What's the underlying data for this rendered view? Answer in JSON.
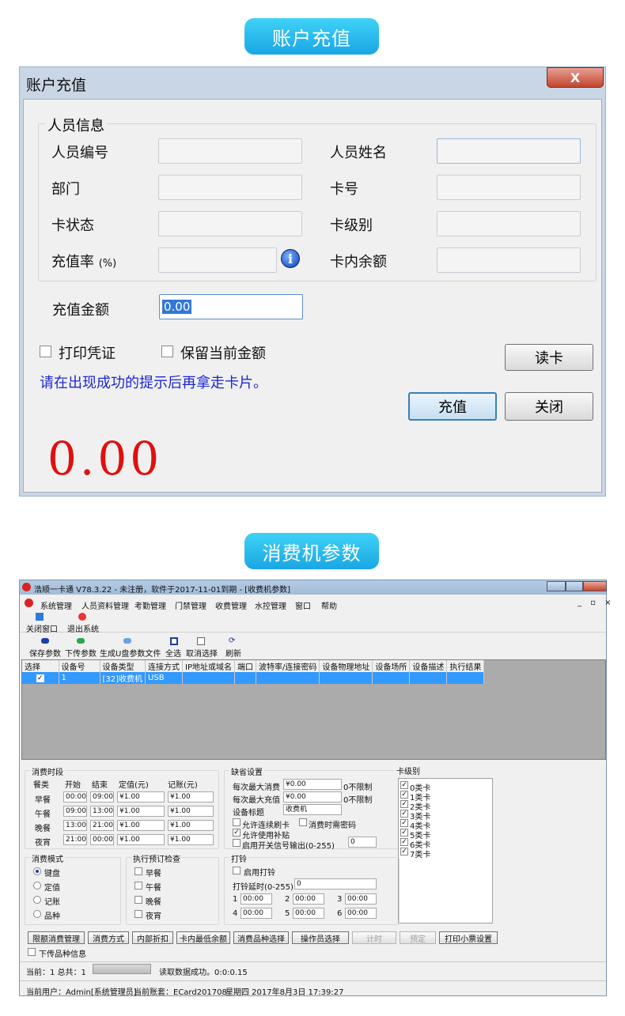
{
  "section1_title": "账户充值",
  "section2_title": "消费机参数",
  "recharge": {
    "window_title": "账户充值",
    "close_glyph": "X",
    "group_title": "人员信息",
    "labels": {
      "emp_no": "人员编号",
      "emp_name": "人员姓名",
      "dept": "部门",
      "card_no": "卡号",
      "card_status": "卡状态",
      "card_level": "卡级别",
      "rate": "充值率",
      "rate_unit": "(%)",
      "balance": "卡内余额",
      "amount": "充值金额"
    },
    "amount_value": "0.00",
    "print_voucher": "打印凭证",
    "keep_amount": "保留当前金额",
    "hint": "请在出现成功的提示后再拿走卡片。",
    "read_card": "读卡",
    "recharge_btn": "充值",
    "close_btn": "关闭",
    "big_amount": "0.00",
    "hint_color": "#1c27d6",
    "big_color": "#e01010"
  },
  "consume": {
    "title": "浩顺一卡通 V78.3.22 - 未注册，软件于2017-11-01到期 - [收费机参数]",
    "menu": [
      "系统管理",
      "人员资料管理",
      "考勤管理",
      "门禁管理",
      "收费管理",
      "水控管理",
      "窗口",
      "帮助"
    ],
    "mdi_controls": "_ ▫ ×",
    "toolbar1": [
      "关闭窗口",
      "退出系统"
    ],
    "toolbar2": [
      "保存参数",
      "下传参数",
      "生成U盘参数文件",
      "全选",
      "取消选择",
      "刷新"
    ],
    "columns": [
      "选择",
      "设备号",
      "设备类型",
      "连接方式",
      "IP地址或域名",
      "端口",
      "波特率/连接密码",
      "设备物理地址",
      "设备场所",
      "设备描述",
      "执行结果"
    ],
    "row": {
      "checked": "✓",
      "id": "1",
      "type": "[32]收费机",
      "conn": "USB"
    },
    "period": {
      "title": "消费时段",
      "headers": [
        "餐类",
        "开始",
        "结束",
        "定值(元)",
        "记账(元)"
      ],
      "rows": [
        {
          "name": "早餐",
          "start": "00:00",
          "end": "09:00",
          "fixed": "¥1.00",
          "acc": "¥1.00"
        },
        {
          "name": "午餐",
          "start": "09:00",
          "end": "13:00",
          "fixed": "¥1.00",
          "acc": "¥1.00"
        },
        {
          "name": "晚餐",
          "start": "13:00",
          "end": "21:00",
          "fixed": "¥1.00",
          "acc": "¥1.00"
        },
        {
          "name": "夜宵",
          "start": "21:00",
          "end": "00:00",
          "fixed": "¥1.00",
          "acc": "¥1.00"
        }
      ]
    },
    "defaults": {
      "title": "缺省设置",
      "max_consume": "每次最大消费",
      "max_consume_v": "¥0.00",
      "max_consume_n": "0不限制",
      "max_recharge": "每次最大充值",
      "max_recharge_v": "¥0.00",
      "max_recharge_n": "0不限制",
      "dev_title": "设备标题",
      "dev_title_v": "收费机",
      "c1": "允许连续刷卡",
      "c2": "消费时需密码",
      "c3": "允许使用补贴",
      "c4": "启用开关信号输出(0-255)",
      "c4_v": "0"
    },
    "card_level": {
      "title": "卡级别",
      "items": [
        "0类卡",
        "1类卡",
        "2类卡",
        "3类卡",
        "4类卡",
        "5类卡",
        "6类卡",
        "7类卡"
      ]
    },
    "mode": {
      "title": "消费模式",
      "items": [
        "键盘",
        "定值",
        "记账",
        "品种"
      ]
    },
    "check": {
      "title": "执行预订检查",
      "items": [
        "早餐",
        "午餐",
        "晚餐",
        "夜宵"
      ]
    },
    "bell": {
      "title": "打铃",
      "enable": "启用打铃",
      "delay": "打铃延时(0-255)",
      "delay_v": "0",
      "slots": [
        {
          "n": "1",
          "v": "00:00"
        },
        {
          "n": "2",
          "v": "00:00"
        },
        {
          "n": "3",
          "v": "00:00"
        },
        {
          "n": "4",
          "v": "00:00"
        },
        {
          "n": "5",
          "v": "00:00"
        },
        {
          "n": "6",
          "v": "00:00"
        }
      ]
    },
    "buttons": [
      "限额消费管理",
      "消费方式",
      "内部折扣",
      "卡内最低余额",
      "消费品种选择",
      "操作员选择",
      "计时",
      "预定",
      "打印小票设置"
    ],
    "upload_info": "下传品种信息",
    "status1": {
      "pos": "当前：1  总共：1",
      "msg": "读取数据成功。0:0:0.15"
    },
    "status2": {
      "user": "当前用户：Admin[系统管理员]",
      "acct": "当前账套：ECard201708",
      "date": "星期四  2017年8月3日  17:39:27"
    }
  }
}
